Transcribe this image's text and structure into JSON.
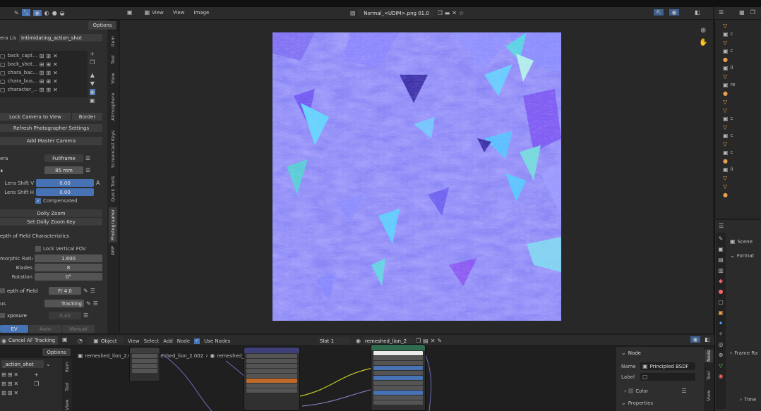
{
  "viewport": {
    "menu": {
      "view": "View",
      "view2": "View",
      "image": "Image"
    },
    "image_name": "Normal_<UDIM>.png 01.0"
  },
  "left_panel": {
    "options": "Options",
    "camera_list_label": "era Lis",
    "camera_list_value": "Intimidating_action_shot",
    "cameras": [
      "back_capt…",
      "back_shot…",
      "chara_bac…",
      "chara_bus…",
      "character_…"
    ],
    "lock_camera": "Lock Camera to View",
    "border": "Border",
    "refresh": "Refresh Photographer Settings",
    "add_master": "Add Master Camera",
    "camera_label": "era",
    "fullframe": "Fullframe",
    "focal": "85 mm",
    "lens_shift_v_label": "Lens Shift V",
    "lens_shift_v": "0.00",
    "lens_shift_h_label": "Lens Shift H",
    "lens_shift_h": "0.00",
    "compensated": "Compensated",
    "dolly_zoom": "Dolly Zoom",
    "set_dolly": "Set Dolly Zoom Key",
    "dof_char": "epth of Field Characteristics",
    "lock_vfov": "Lock Vertical FOV",
    "morphic_label": "morphic Ratio",
    "morphic": "1.600",
    "blades_label": "Blades",
    "blades": "8",
    "rotation_label": "Rotation",
    "rotation": "0°",
    "dof_label": "epth of Field",
    "fstop": "F/ 4.0",
    "af_label": "us",
    "tracking": "Tracking",
    "exposure_label": "xposure",
    "exposure": "0.40",
    "auto": "Auto",
    "manual": "Manual",
    "ev": "EV"
  },
  "side_tabs": [
    "Item",
    "Tool",
    "View",
    "Atmosphere",
    "Screencast Keys",
    "Quick Tools",
    "Photographer",
    "ARP"
  ],
  "node_editor": {
    "cancel_af": "Cancel AF Tracking",
    "options": "Options",
    "shot": "_action_shot",
    "object": "Object",
    "view": "View",
    "select": "Select",
    "add": "Add",
    "node": "Node",
    "use_nodes": "Use Nodes",
    "slot": "Slot 1",
    "material": "remeshed_lion_2",
    "breadcrumb": [
      "remeshed_lion_2.001",
      "remeshed_lion_2.002",
      "remeshed_lion_2"
    ],
    "tabs": [
      "Node",
      "Tool",
      "View"
    ]
  },
  "node_panel": {
    "node_title": "Node",
    "name_label": "Name",
    "name_value": "Principled BSDF",
    "label_label": "Label",
    "color": "Color",
    "properties": "Properties"
  },
  "properties_editor": {
    "scene": "Scene",
    "format": "Format",
    "frame_range": "Frame Ra",
    "time": "Time"
  },
  "colors": {
    "normal_map": "#8080ff",
    "accent_blue": "#4772b3"
  }
}
